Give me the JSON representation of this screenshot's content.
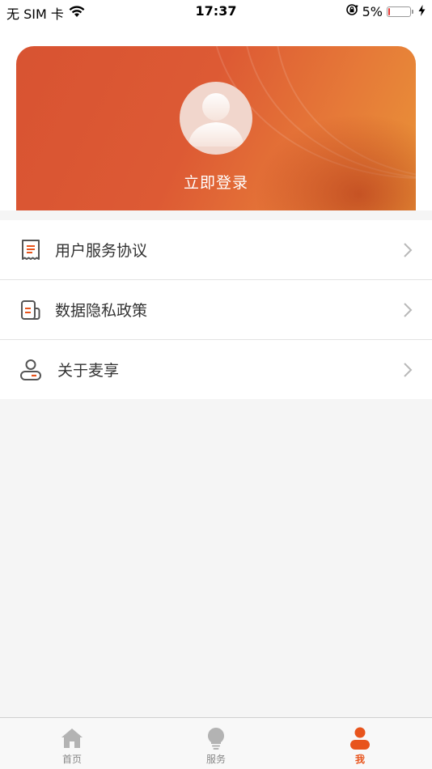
{
  "status_bar": {
    "carrier": "无 SIM 卡",
    "time": "17:37",
    "battery_percent": "5%",
    "battery_level": 0.05
  },
  "profile": {
    "login_label": "立即登录"
  },
  "menu": {
    "items": [
      {
        "label": "用户服务协议",
        "icon": "document-list-icon"
      },
      {
        "label": "数据隐私政策",
        "icon": "privacy-document-icon"
      },
      {
        "label": "关于麦享",
        "icon": "user-card-icon"
      }
    ]
  },
  "tab_bar": {
    "tabs": [
      {
        "label": "首页",
        "icon": "home-icon"
      },
      {
        "label": "服务",
        "icon": "lightbulb-icon"
      },
      {
        "label": "我",
        "icon": "person-icon",
        "active": true
      }
    ]
  },
  "colors": {
    "accent": "#e8541c",
    "card_start": "#d85332",
    "card_end": "#e99437",
    "inactive": "#aaaaaa"
  }
}
